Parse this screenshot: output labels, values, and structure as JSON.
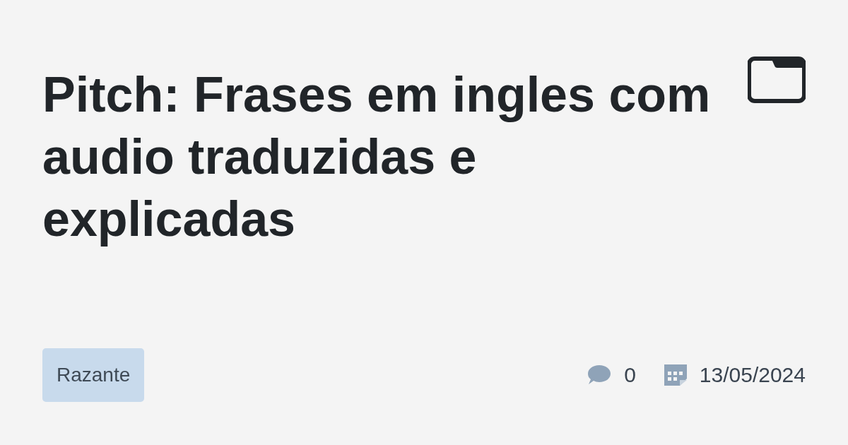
{
  "title": "Pitch: Frases em ingles com audio traduzidas e explicadas",
  "tag": {
    "label": "Razante"
  },
  "meta": {
    "comments": "0",
    "date": "13/05/2024"
  }
}
